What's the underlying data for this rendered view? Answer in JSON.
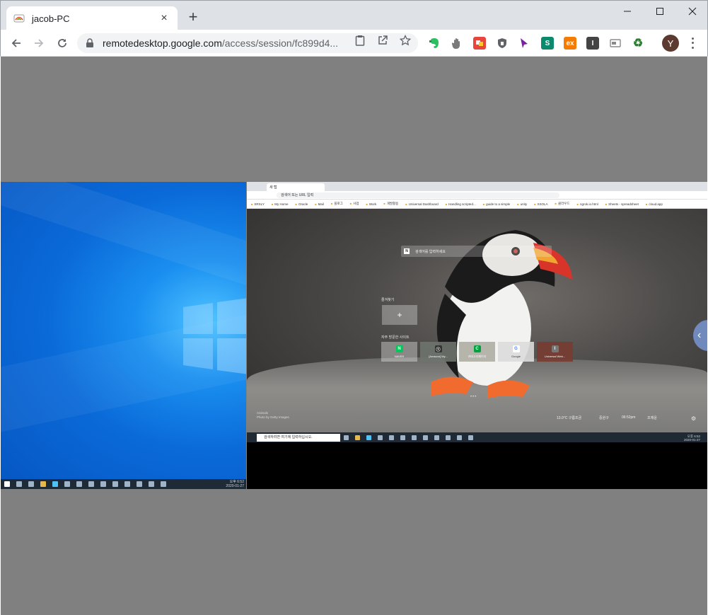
{
  "tab": {
    "title": "jacob-PC",
    "close_label": "×"
  },
  "newtab_label": "+",
  "window_controls": {
    "minimize": "—",
    "maximize": "☐",
    "close": "✕"
  },
  "omnibox": {
    "host": "remotedesktop.google.com",
    "path": "/access/session/fc899d4..."
  },
  "extensions": [
    {
      "name": "evernote-icon",
      "color": "#2dbe60",
      "glyph": ""
    },
    {
      "name": "hand-icon",
      "color": "#7a7a7a",
      "glyph": ""
    },
    {
      "name": "stack-icon",
      "color": "#e8453c",
      "glyph": ""
    },
    {
      "name": "shield-icon",
      "color": "#5f6368",
      "glyph": ""
    },
    {
      "name": "cursor-icon",
      "color": "#7a1fa2",
      "glyph": ""
    },
    {
      "name": "s-extension-icon",
      "color": "#0c8a6e",
      "glyph": "S"
    },
    {
      "name": "ex-extension-icon",
      "color": "#f57c00",
      "glyph": "ex"
    },
    {
      "name": "instapaper-icon",
      "color": "#444444",
      "glyph": "I"
    },
    {
      "name": "card-icon",
      "color": "#8a8a8a",
      "glyph": ""
    },
    {
      "name": "recycle-icon",
      "color": "#2e7d32",
      "glyph": "♻"
    }
  ],
  "profile_initial": "Y",
  "left_monitor": {
    "clock_time": "오후 6:52",
    "clock_date": "2020-01-27"
  },
  "right_monitor": {
    "tab_title": "새 탭",
    "omnibox_text": "검색어 또는 URL 입력",
    "bookmarks": [
      "SRSLY",
      "My Home",
      "Oracle",
      "Mail",
      "블로그",
      "사업",
      "Work",
      "개발활용",
      "Universal Dashboard",
      "Handling scripted...",
      "guide to a simple",
      "unity",
      "XSOLA",
      "클라우드",
      "ngrok.io.html",
      "Sheets - spreadsheet",
      "cloud.app"
    ],
    "search_placeholder": "검색어를 입력하세요",
    "add_section_label": "즐겨찾기",
    "add_tile_label": "+",
    "recent_section_label": "자주 방문한 사이트",
    "tiles": [
      {
        "name": "NAVER",
        "glyph": "N",
        "bg": "#03c75a",
        "tile_bg": "rgba(255,255,255,0.35)"
      },
      {
        "name": "[Amazon] My...",
        "glyph": "ⓣ",
        "bg": "#333333",
        "tile_bg": "rgba(110,115,110,0.9)"
      },
      {
        "name": "카테고리페이지",
        "glyph": "C",
        "bg": "#00a33e",
        "tile_bg": "rgba(170,170,160,0.85)"
      },
      {
        "name": "Google",
        "glyph": "G",
        "bg": "#ffffff",
        "tile_bg": "rgba(220,220,220,0.9)"
      },
      {
        "name": "Universal Web...",
        "glyph": "I",
        "bg": "#777777",
        "tile_bg": "rgba(120,60,50,0.9)"
      }
    ],
    "credit_title": "Animals",
    "credit_sub": "Photo by Getty Images",
    "weather": "13.0°C 구름조금",
    "location": "중원구",
    "time": "06:52pm",
    "user": "조재윤",
    "taskbar_search": "검색하려면 여기에 입력하십시오.",
    "clock_time": "오후 6:52",
    "clock_date": "2020-01-27"
  }
}
